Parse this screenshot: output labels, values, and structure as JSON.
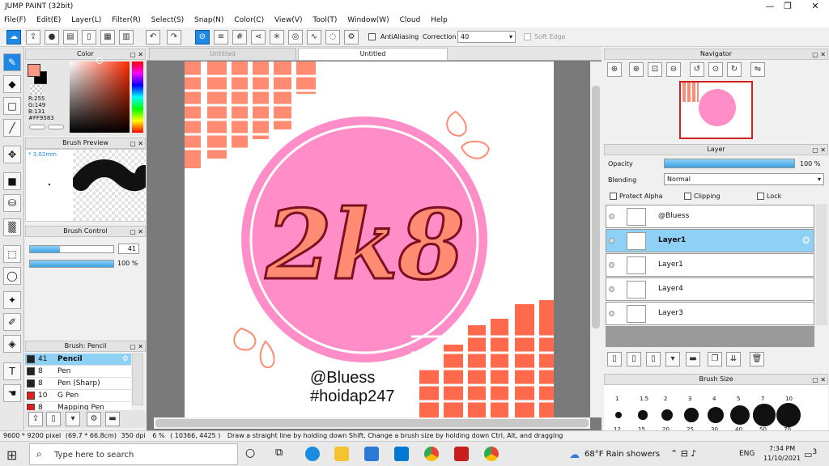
{
  "window": {
    "title": "JUMP PAINT (32bit)",
    "minimize": "—",
    "maximize": "❐",
    "close": "✕"
  },
  "menu": [
    "File(F)",
    "Edit(E)",
    "Layer(L)",
    "Filter(R)",
    "Select(S)",
    "Snap(N)",
    "Color(C)",
    "View(V)",
    "Tool(T)",
    "Window(W)",
    "Cloud",
    "Help"
  ],
  "toolbar": {
    "antialiasing_label": "AntiAliasing",
    "correction_label": "Correction",
    "correction_value": "40",
    "soft_edge_label": "Soft Edge"
  },
  "color_panel": {
    "title": "Color",
    "r": "R:255",
    "g": "G:149",
    "b": "B:131",
    "hex": "#FF9583",
    "fg_color": "#ff9583"
  },
  "brush_preview": {
    "title": "Brush Preview",
    "size": "3.02mm"
  },
  "brush_control": {
    "title": "Brush Control",
    "size_value": "41",
    "opacity_value": "100",
    "opacity_unit": "%",
    "size_level": 0.36,
    "opacity_level": 1.0
  },
  "brush_list": {
    "title": "Brush: Pencil",
    "items": [
      {
        "size": "41",
        "name": "Pencil",
        "selected": true,
        "color": "#222"
      },
      {
        "size": "8",
        "name": "Pen",
        "selected": false,
        "color": "#222"
      },
      {
        "size": "8",
        "name": "Pen (Sharp)",
        "selected": false,
        "color": "#222"
      },
      {
        "size": "10",
        "name": "G Pen",
        "selected": false,
        "color": "#e02020"
      },
      {
        "size": "8",
        "name": "Mapping Pen",
        "selected": false,
        "color": "#e02020"
      }
    ]
  },
  "tabs": [
    {
      "label": "Untitled"
    },
    {
      "label": "Untitled"
    }
  ],
  "artwork": {
    "main_text": "2k8",
    "handle": "@Bluess",
    "hashtag": "#hoidap247"
  },
  "navigator": {
    "title": "Navigator"
  },
  "layer_panel": {
    "title": "Layer",
    "opacity_label": "Opacity",
    "opacity_value": "100",
    "opacity_unit": "%",
    "opacity_level": 1.0,
    "blending_label": "Blending",
    "blending_value": "Normal",
    "protect_alpha_label": "Protect Alpha",
    "clipping_label": "Clipping",
    "lock_label": "Lock",
    "layers": [
      {
        "name": "@Bluess",
        "selected": false,
        "bold": false
      },
      {
        "name": "Layer1",
        "selected": true,
        "bold": true
      },
      {
        "name": "Layer1",
        "selected": false,
        "bold": false
      },
      {
        "name": "Layer4",
        "selected": false,
        "bold": false
      },
      {
        "name": "Layer3",
        "selected": false,
        "bold": false
      }
    ]
  },
  "brush_size": {
    "title": "Brush Size",
    "sizes": [
      "1",
      "1.5",
      "2",
      "3",
      "4",
      "5",
      "7",
      "10"
    ],
    "sizes2": [
      "12",
      "15",
      "20",
      "25",
      "30",
      "40",
      "50",
      "70"
    ]
  },
  "status": {
    "dimensions": "9600 * 9200 pixel",
    "physical": "(69.7 * 66.8cm)",
    "dpi": "350 dpi",
    "zoom": "6 %",
    "coords": "( 10366, 4425 )",
    "hint": "Draw a straight line by holding down Shift, Change a brush size by holding down Ctrl, Alt, and dragging"
  },
  "taskbar": {
    "search_placeholder": "Type here to search",
    "weather": "68°F  Rain showers",
    "lang": "ENG",
    "time": "7:34 PM",
    "date": "11/10/2021",
    "notifications": "3"
  }
}
